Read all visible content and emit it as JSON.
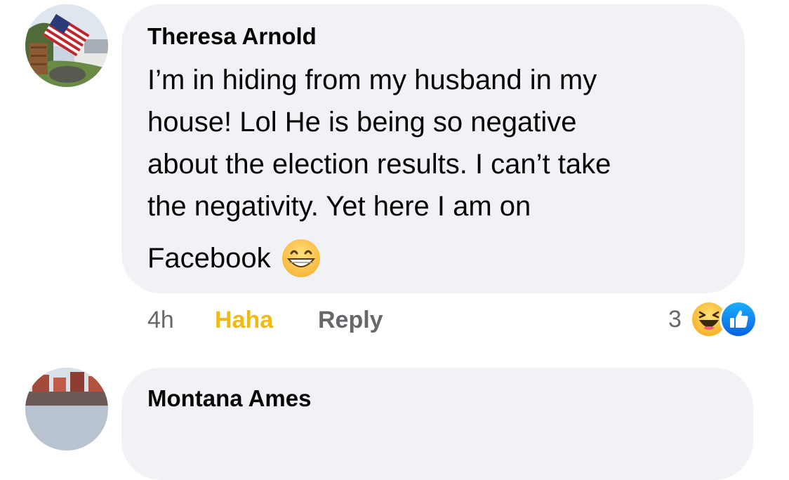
{
  "comments": [
    {
      "author": "Theresa Arnold",
      "text_lines": [
        "I’m in hiding from my husband in my",
        "house! Lol He is being so negative",
        "about the election results. I can’t take",
        "the negativity. Yet here I am on",
        "Facebook"
      ],
      "text_emoji": "grinning-face-icon",
      "meta": {
        "time": "4h",
        "haha_label": "Haha",
        "reply_label": "Reply"
      },
      "reactions": {
        "count": "3",
        "icons": [
          "haha-reaction-icon",
          "like-reaction-icon"
        ]
      }
    },
    {
      "author": "Montana Ames"
    }
  ],
  "colors": {
    "bubble_bg": "#f0f2f5",
    "text": "#050505",
    "secondary": "#65676b",
    "haha": "#f0ba15",
    "like_blue": "#1877f2"
  }
}
